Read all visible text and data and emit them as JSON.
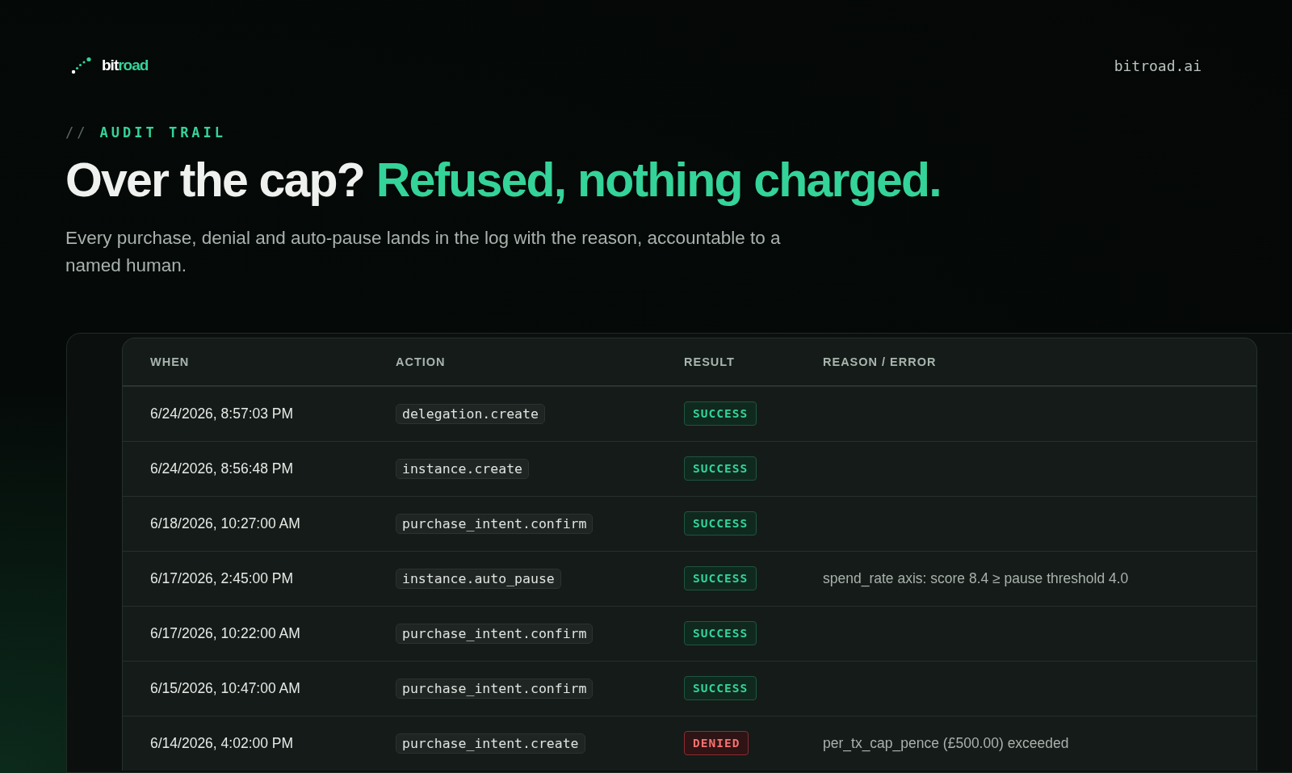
{
  "header": {
    "logo": {
      "prefix": "bit",
      "suffix": "road"
    },
    "link": "bitroad.ai"
  },
  "hero": {
    "eyebrow_mark": "//",
    "eyebrow": "AUDIT TRAIL",
    "headline_lead": "Over the cap?",
    "headline_accent": "Refused, nothing charged.",
    "description": "Every purchase, denial and auto-pause lands in the log with the reason, accountable to a named human."
  },
  "table": {
    "columns": [
      "WHEN",
      "ACTION",
      "RESULT",
      "REASON / ERROR"
    ],
    "rows": [
      {
        "when": "6/24/2026, 8:57:03 PM",
        "action": "delegation.create",
        "result": {
          "label": "SUCCESS",
          "kind": "success"
        }
      },
      {
        "when": "6/24/2026, 8:56:48 PM",
        "action": "instance.create",
        "result": {
          "label": "SUCCESS",
          "kind": "success"
        }
      },
      {
        "when": "6/18/2026, 10:27:00 AM",
        "action": "purchase_intent.confirm",
        "result": {
          "label": "SUCCESS",
          "kind": "success"
        }
      },
      {
        "when": "6/17/2026, 2:45:00 PM",
        "action": "instance.auto_pause",
        "result": {
          "label": "SUCCESS",
          "kind": "success"
        },
        "reason": "spend_rate axis: score 8.4 ≥ pause threshold 4.0"
      },
      {
        "when": "6/17/2026, 10:22:00 AM",
        "action": "purchase_intent.confirm",
        "result": {
          "label": "SUCCESS",
          "kind": "success"
        }
      },
      {
        "when": "6/15/2026, 10:47:00 AM",
        "action": "purchase_intent.confirm",
        "result": {
          "label": "SUCCESS",
          "kind": "success"
        }
      },
      {
        "when": "6/14/2026, 4:02:00 PM",
        "action": "purchase_intent.create",
        "result": {
          "label": "DENIED",
          "kind": "denied"
        },
        "reason": "per_tx_cap_pence (£500.00) exceeded"
      }
    ]
  }
}
